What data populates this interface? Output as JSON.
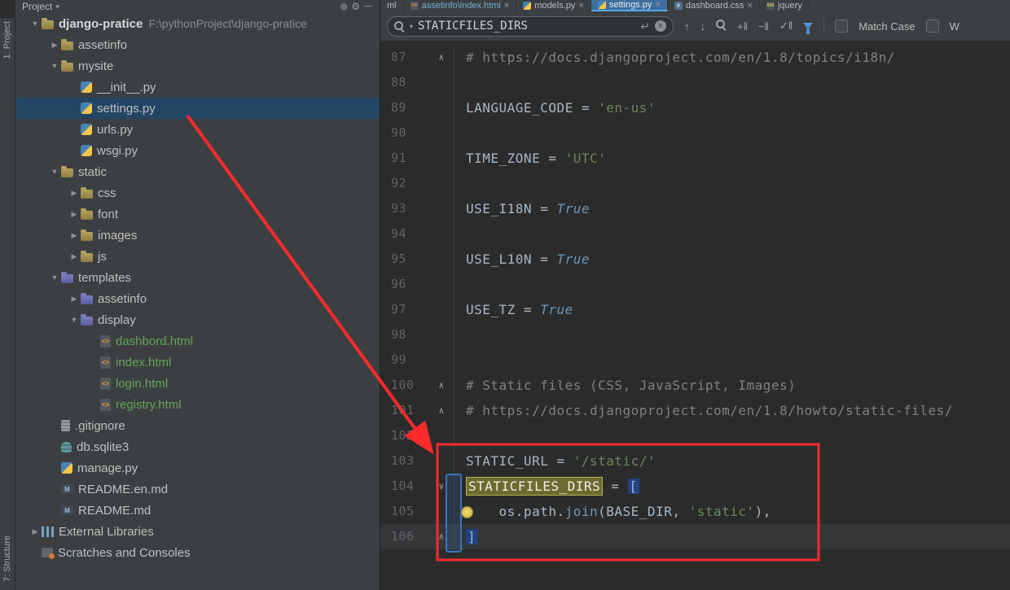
{
  "tool_windows": {
    "top": "1: Project",
    "bottom": "7: Structure"
  },
  "project": {
    "header": {
      "title": "Project"
    },
    "tree": [
      {
        "label": "django-pratice",
        "path": "F:\\pythonProject\\django-pratice",
        "level": 0,
        "arrow": "expanded",
        "icon": "folder",
        "bold": true
      },
      {
        "label": "assetinfo",
        "level": 1,
        "arrow": "collapsed",
        "icon": "folder"
      },
      {
        "label": "mysite",
        "level": 1,
        "arrow": "expanded",
        "icon": "folder"
      },
      {
        "label": "__init__.py",
        "level": 2,
        "icon": "python"
      },
      {
        "label": "settings.py",
        "level": 2,
        "icon": "python",
        "selected": true
      },
      {
        "label": "urls.py",
        "level": 2,
        "icon": "python"
      },
      {
        "label": "wsgi.py",
        "level": 2,
        "icon": "python"
      },
      {
        "label": "static",
        "level": 1,
        "arrow": "expanded",
        "icon": "folder"
      },
      {
        "label": "css",
        "level": 2,
        "arrow": "collapsed",
        "icon": "folder"
      },
      {
        "label": "font",
        "level": 2,
        "arrow": "collapsed",
        "icon": "folder"
      },
      {
        "label": "images",
        "level": 2,
        "arrow": "collapsed",
        "icon": "folder"
      },
      {
        "label": "js",
        "level": 2,
        "arrow": "collapsed",
        "icon": "folder"
      },
      {
        "label": "templates",
        "level": 1,
        "arrow": "expanded",
        "icon": "folder-templates"
      },
      {
        "label": "assetinfo",
        "level": 2,
        "arrow": "collapsed",
        "icon": "folder-templates"
      },
      {
        "label": "display",
        "level": 2,
        "arrow": "expanded",
        "icon": "folder-templates"
      },
      {
        "label": "dashbord.html",
        "level": 3,
        "icon": "html",
        "color": "green"
      },
      {
        "label": "index.html",
        "level": 3,
        "icon": "html",
        "color": "green"
      },
      {
        "label": "login.html",
        "level": 3,
        "icon": "html",
        "color": "green"
      },
      {
        "label": "registry.html",
        "level": 3,
        "icon": "html",
        "color": "green"
      },
      {
        "label": ".gitignore",
        "level": 1,
        "icon": "text"
      },
      {
        "label": "db.sqlite3",
        "level": 1,
        "icon": "database"
      },
      {
        "label": "manage.py",
        "level": 1,
        "icon": "python"
      },
      {
        "label": "README.en.md",
        "level": 1,
        "icon": "markdown"
      },
      {
        "label": "README.md",
        "level": 1,
        "icon": "markdown"
      },
      {
        "label": "External Libraries",
        "level": 0,
        "arrow": "collapsed",
        "icon": "libraries"
      },
      {
        "label": "Scratches and Consoles",
        "level": 0,
        "icon": "scratches"
      }
    ]
  },
  "editor": {
    "tabs": [
      {
        "label": "ml",
        "active": false,
        "closable": false
      },
      {
        "label": "assetinfo\\index.html",
        "icon": "html",
        "active": false,
        "tint": "#6fb3d2"
      },
      {
        "label": "models.py",
        "icon": "python",
        "active": false
      },
      {
        "label": "settings.py",
        "icon": "python",
        "active": true
      },
      {
        "label": "dashboard.css",
        "icon": "css",
        "active": false
      },
      {
        "label": "jquery",
        "icon": "js",
        "active": false,
        "closable": false
      }
    ],
    "find": {
      "query": "STATICFILES_DIRS",
      "match_case_label": "Match Case",
      "words_label": "W"
    },
    "code": {
      "lines": [
        {
          "n": "87",
          "fold": "up",
          "tokens": [
            [
              "comment",
              "# https://docs.djangoproject.com/en/1.8/topics/i18n/"
            ]
          ]
        },
        {
          "n": "88",
          "tokens": []
        },
        {
          "n": "89",
          "tokens": [
            [
              "plain",
              "LANGUAGE_CODE "
            ],
            [
              "op",
              "= "
            ],
            [
              "string",
              "'en-us'"
            ]
          ]
        },
        {
          "n": "90",
          "tokens": []
        },
        {
          "n": "91",
          "tokens": [
            [
              "plain",
              "TIME_ZONE "
            ],
            [
              "op",
              "= "
            ],
            [
              "string",
              "'UTC'"
            ]
          ]
        },
        {
          "n": "92",
          "tokens": []
        },
        {
          "n": "93",
          "tokens": [
            [
              "plain",
              "USE_I18N "
            ],
            [
              "op",
              "= "
            ],
            [
              "builtin",
              "True"
            ]
          ]
        },
        {
          "n": "94",
          "tokens": []
        },
        {
          "n": "95",
          "tokens": [
            [
              "plain",
              "USE_L10N "
            ],
            [
              "op",
              "= "
            ],
            [
              "builtin",
              "True"
            ]
          ]
        },
        {
          "n": "96",
          "tokens": []
        },
        {
          "n": "97",
          "tokens": [
            [
              "plain",
              "USE_TZ "
            ],
            [
              "op",
              "= "
            ],
            [
              "builtin",
              "True"
            ]
          ]
        },
        {
          "n": "98",
          "tokens": []
        },
        {
          "n": "99",
          "tokens": []
        },
        {
          "n": "100",
          "fold": "up",
          "tokens": [
            [
              "comment",
              "# Static files (CSS, JavaScript, Images)"
            ]
          ]
        },
        {
          "n": "101",
          "fold": "up",
          "tokens": [
            [
              "comment",
              "# https://docs.djangoproject.com/en/1.8/howto/static-files/"
            ]
          ]
        },
        {
          "n": "102",
          "tokens": []
        },
        {
          "n": "103",
          "tokens": [
            [
              "plain",
              "STATIC_URL "
            ],
            [
              "op",
              "= "
            ],
            [
              "string",
              "'/static/'"
            ]
          ]
        },
        {
          "n": "104",
          "fold": "down",
          "tokens": [
            [
              "match",
              "STATICFILES_DIRS"
            ],
            [
              "op",
              " = "
            ],
            [
              "brace",
              "["
            ]
          ]
        },
        {
          "n": "105",
          "bulb": true,
          "tokens": [
            [
              "plain",
              "    os.path."
            ],
            [
              "func",
              "join"
            ],
            [
              "plain",
              "(BASE_DIR, "
            ],
            [
              "string",
              "'static'"
            ],
            [
              "plain",
              "),"
            ]
          ]
        },
        {
          "n": "106",
          "fold": "end",
          "current": true,
          "tokens": [
            [
              "brace",
              "]"
            ]
          ]
        }
      ]
    }
  },
  "colors": {
    "annotation_red": "#fb2b2b",
    "search_match_bg": "#6e6b2f",
    "brace_selection_blue": "#214283",
    "active_tab_blue": "#3c6e9e",
    "tree_selection_blue": "#234665",
    "editor_bg": "#2b2b2b",
    "panel_bg": "#3c3f41"
  }
}
